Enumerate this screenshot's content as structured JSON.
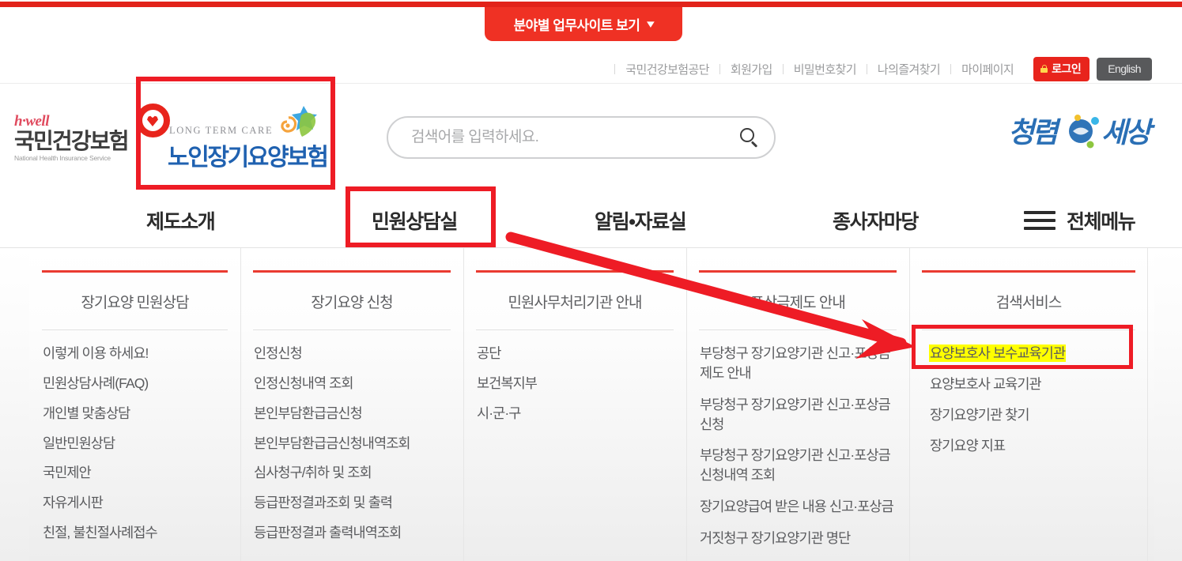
{
  "banner": {
    "label": "분야별 업무사이트 보기",
    "chevron_icon": "chevron-down-icon"
  },
  "util_nav": {
    "links": [
      "국민건강보험공단",
      "회원가입",
      "비밀번호찾기",
      "나의즐겨찾기",
      "마이페이지"
    ],
    "login_label": "로그인",
    "login_icon": "lock-icon",
    "english_label": "English"
  },
  "header": {
    "logo_nhis": {
      "hwell": "h·well",
      "korean": "국민건강보험",
      "english": "National Health Insurance Service"
    },
    "logo_ltc": {
      "english": "LONG TERM CARE",
      "korean": "노인장기요양보험"
    },
    "logo_clean": {
      "text": "청렴세상"
    }
  },
  "search": {
    "placeholder": "검색어를 입력하세요.",
    "value": "",
    "icon": "search-icon"
  },
  "main_nav": {
    "items": [
      "제도소개",
      "민원상담실",
      "알림•자료실",
      "종사자마당"
    ],
    "all_menu_label": "전체메뉴",
    "all_menu_icon": "hamburger-icon"
  },
  "mega_menu": {
    "columns": [
      {
        "title": "장기요양 민원상담",
        "links": [
          "이렇게 이용 하세요!",
          "민원상담사례(FAQ)",
          "개인별 맞춤상담",
          "일반민원상담",
          "국민제안",
          "자유게시판",
          "친절, 불친절사례접수"
        ]
      },
      {
        "title": "장기요양 신청",
        "links": [
          "인정신청",
          "인정신청내역 조회",
          "본인부담환급금신청",
          "본인부담환급금신청내역조회",
          "심사청구/취하 및 조회",
          "등급판정결과조회 및 출력",
          "등급판정결과 출력내역조회"
        ]
      },
      {
        "title": "민원사무처리기관 안내",
        "links": [
          "공단",
          "보건복지부",
          "시·군·구"
        ]
      },
      {
        "title": "포상금제도 안내",
        "links": [
          "부당청구 장기요양기관 신고·포상금 제도 안내",
          "부당청구 장기요양기관 신고·포상금 신청",
          "부당청구 장기요양기관 신고·포상금 신청내역 조회",
          "장기요양급여 받은 내용 신고·포상금",
          "거짓청구 장기요양기관 명단"
        ]
      },
      {
        "title": "검색서비스",
        "links": [
          "요양보호사 보수교육기관",
          "요양보호사 교육기관",
          "장기요양기관 찾기",
          "장기요양 지표"
        ],
        "highlighted_index": 0
      }
    ]
  },
  "annotations": {
    "boxes": [
      {
        "target": "노인장기요양보험 로고"
      },
      {
        "target": "민원상담실"
      },
      {
        "target": "요양보호사 보수교육기관"
      }
    ],
    "arrow": {
      "from": "민원상담실",
      "to": "요양보호사 보수교육기관"
    },
    "accent_color": "#ee1c25",
    "highlight_color": "#ffff00"
  }
}
